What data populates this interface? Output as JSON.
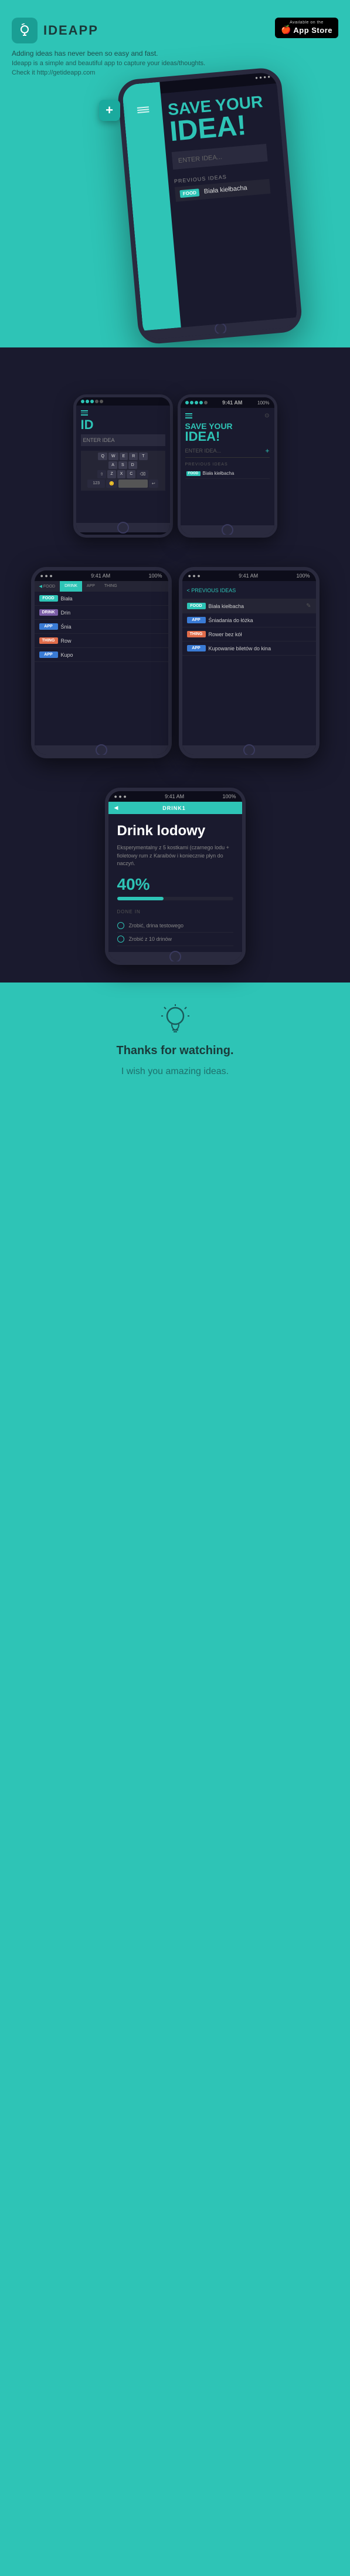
{
  "app": {
    "name": "IDEAPP",
    "tagline": "Adding ideas has never been so easy and fast.",
    "description": "Ideapp is a simple and beautiful app to capture your ideas/thoughts.",
    "link": "Check it http://getideapp.com",
    "appstore": {
      "available_label": "Available on the",
      "store_label": "App Store"
    }
  },
  "hero_phone": {
    "save_title": "SAVE YOUR",
    "idea_title": "IDEA!",
    "enter_placeholder": "ENTER IDEA...",
    "previous_label": "PREVIOUS IDEAS",
    "ideas": [
      {
        "tag": "FOOD",
        "text": "Biała kiełbacha"
      }
    ]
  },
  "section2": {
    "phones": [
      {
        "id": "phone-keyboard",
        "status_time": "",
        "header": "ID",
        "enter_text": "ENTER IDEA",
        "keyboard_rows": [
          [
            "Q",
            "W",
            "E",
            "R",
            "T"
          ],
          [
            "A",
            "S",
            "D",
            "F"
          ],
          [
            "Z",
            "X",
            "C"
          ],
          [
            "123"
          ]
        ]
      },
      {
        "id": "phone-list",
        "status_time": "9:41 AM",
        "status_battery": "100%",
        "save_label": "SAVE YOUR",
        "idea_label": "IDEA!",
        "enter_placeholder": "ENTER IDEA...",
        "previous_label": "PREVIOUS IDEAS",
        "ideas": [
          {
            "tag": "FOOD",
            "text": "Biała kiełbacha",
            "tag_color": "teal"
          }
        ]
      }
    ]
  },
  "section3": {
    "phones": [
      {
        "id": "phone-list-left",
        "status_time": "9:41 AM",
        "status_battery": "100%",
        "tabs": [
          "FOOD",
          "DRINK",
          "APP",
          "THING"
        ],
        "active_tab": "FOOD",
        "ideas": [
          {
            "tag": "FOOD",
            "tag_color": "tag-food",
            "text": "Biała"
          },
          {
            "tag": "DRINK",
            "tag_color": "tag-drink",
            "text": "Drin"
          },
          {
            "tag": "APP",
            "tag_color": "tag-app",
            "text": "Śnia"
          },
          {
            "tag": "THING",
            "tag_color": "tag-thing",
            "text": "Row"
          },
          {
            "tag": "APP",
            "tag_color": "tag-app",
            "text": "Kupo"
          }
        ]
      },
      {
        "id": "phone-list-right",
        "status_time": "9:41 AM",
        "status_battery": "100%",
        "back_label": "< PREVIOUS IDEAS",
        "ideas": [
          {
            "tag": "FOOD",
            "tag_color": "tag-food",
            "text": "Biała kiełbacha",
            "editable": true
          },
          {
            "tag": "APP",
            "tag_color": "tag-app",
            "text": "Śniadania do łóżka",
            "editable": false
          },
          {
            "tag": "THING",
            "tag_color": "tag-thing",
            "text": "Rower bez kół",
            "editable": false
          },
          {
            "tag": "APP",
            "tag_color": "tag-app",
            "text": "Kupowanie biletów do kina",
            "editable": false
          }
        ]
      }
    ]
  },
  "section4": {
    "phone": {
      "status_time": "9:41 AM",
      "status_battery": "100%",
      "header_tab": "DRINK1",
      "idea_title": "Drink lodowy",
      "idea_desc": "Eksperymentalny z 5 kostkami (czarnego lodu + fioletowy rum z Karaibów i koniecznie płyn do naczyń.",
      "progress_percent": "40%",
      "done_label": "DONE IN",
      "todos": [
        {
          "done": false,
          "text": "Zrobić, drina testowego"
        },
        {
          "done": false,
          "text": "Zrobić z 10 drinów"
        }
      ]
    }
  },
  "footer": {
    "title": "Thanks for watching.",
    "subtitle": "I wish you amazing ideas."
  },
  "colors": {
    "teal": "#2ec4b6",
    "dark_bg": "#1a1a2e",
    "darker_bg": "#0d0d1a",
    "purple": "#7b5ea7",
    "blue": "#3a7bd5",
    "orange": "#e06c4a"
  }
}
